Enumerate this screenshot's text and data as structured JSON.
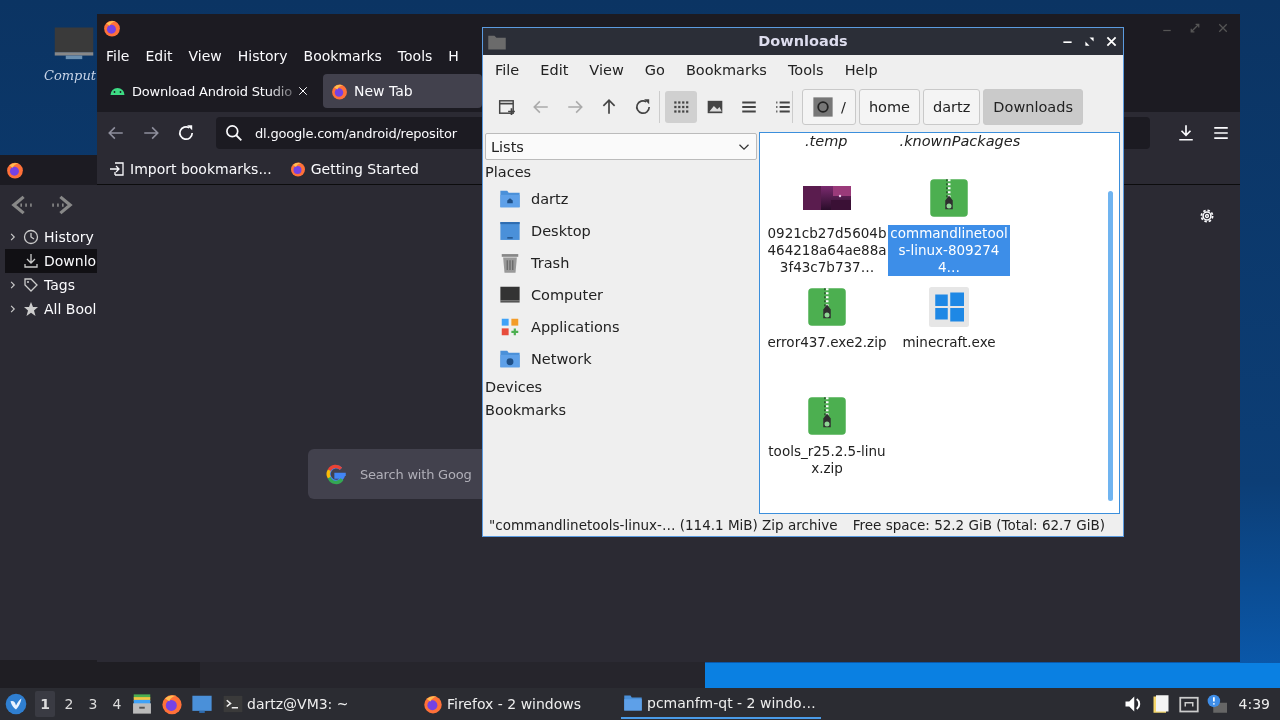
{
  "desktop": {
    "icons": [
      {
        "label": "Comput"
      }
    ]
  },
  "library_window": {
    "tree": [
      {
        "label": "History",
        "kind": "history",
        "expandable": true,
        "selected": false
      },
      {
        "label": "Downlo",
        "kind": "downloads",
        "expandable": false,
        "selected": true
      },
      {
        "label": "Tags",
        "kind": "tags",
        "expandable": true,
        "selected": false
      },
      {
        "label": "All Bool",
        "kind": "bookmarks",
        "expandable": true,
        "selected": false
      }
    ]
  },
  "browser": {
    "menu": [
      "File",
      "Edit",
      "View",
      "History",
      "Bookmarks",
      "Tools",
      "H"
    ],
    "tabs": [
      {
        "label": "Download Android Studio",
        "kind": "android",
        "selected": false
      },
      {
        "label": "New Tab",
        "kind": "browser",
        "selected": true
      }
    ],
    "address": "dl.google.com/android/repositor",
    "bookmarks": [
      {
        "label": "Import bookmarks...",
        "kind": "import"
      },
      {
        "label": "Getting Started",
        "kind": "browser"
      }
    ],
    "search_placeholder": "Search with Goog"
  },
  "file_manager": {
    "title": "Downloads",
    "menu": [
      "File",
      "Edit",
      "View",
      "Go",
      "Bookmarks",
      "Tools",
      "Help"
    ],
    "toolbar": [
      {
        "kind": "new-tab",
        "disabled": false
      },
      {
        "kind": "back",
        "disabled": true
      },
      {
        "kind": "forward",
        "disabled": true
      },
      {
        "kind": "up",
        "disabled": false
      },
      {
        "kind": "reload",
        "disabled": false
      }
    ],
    "views": [
      {
        "kind": "icons",
        "selected": true
      },
      {
        "kind": "thumbnails",
        "selected": false
      },
      {
        "kind": "compact",
        "selected": false
      },
      {
        "kind": "details",
        "selected": false
      }
    ],
    "path": [
      {
        "label": "/",
        "kind": "root",
        "selected": false
      },
      {
        "label": "home",
        "kind": "dir",
        "selected": false
      },
      {
        "label": "dartz",
        "kind": "dir",
        "selected": false
      },
      {
        "label": "Downloads",
        "kind": "dir",
        "selected": true
      }
    ],
    "side_combo": "Lists",
    "sections": [
      {
        "label": "Places",
        "items": [
          {
            "label": "dartz",
            "kind": "home"
          },
          {
            "label": "Desktop",
            "kind": "desktop"
          },
          {
            "label": "Trash",
            "kind": "trash"
          },
          {
            "label": "Computer",
            "kind": "computer"
          },
          {
            "label": "Applications",
            "kind": "applications"
          },
          {
            "label": "Network",
            "kind": "network"
          }
        ]
      },
      {
        "label": "Devices"
      },
      {
        "label": "Bookmarks"
      }
    ],
    "hidden_files_partial": [
      ".temp",
      ".knownPackages"
    ],
    "files": [
      {
        "name": "0921cb27d5604b464218a64ae88a3f43c7b737…",
        "kind": "picture",
        "selected": false
      },
      {
        "name": "commandlinetools-linux-8092744…",
        "kind": "zip",
        "selected": true
      },
      {
        "name": "error437.exe2.zip",
        "kind": "zip",
        "selected": false
      },
      {
        "name": "minecraft.exe",
        "kind": "exe",
        "selected": false
      },
      {
        "name": "tools_r25.2.5-linux.zip",
        "kind": "zip",
        "selected": false
      }
    ],
    "status": {
      "selection": "\"commandlinetools-linux-… (114.1 MiB) Zip archive",
      "free_space": "Free space: 52.2 GiB (Total: 62.7 GiB)"
    }
  },
  "taskbar": {
    "workspaces": [
      {
        "label": "1",
        "selected": true
      },
      {
        "label": "2",
        "selected": false
      },
      {
        "label": "3",
        "selected": false
      },
      {
        "label": "4",
        "selected": false
      }
    ],
    "tasks": [
      {
        "label": "dartz@VM3: ~",
        "kind": "terminal",
        "selected": false
      },
      {
        "label": "Firefox - 2 windows",
        "kind": "browser",
        "selected": false
      },
      {
        "label": "pcmanfm-qt - 2 windo…",
        "kind": "folder",
        "selected": true
      }
    ],
    "clock": "4:39"
  }
}
